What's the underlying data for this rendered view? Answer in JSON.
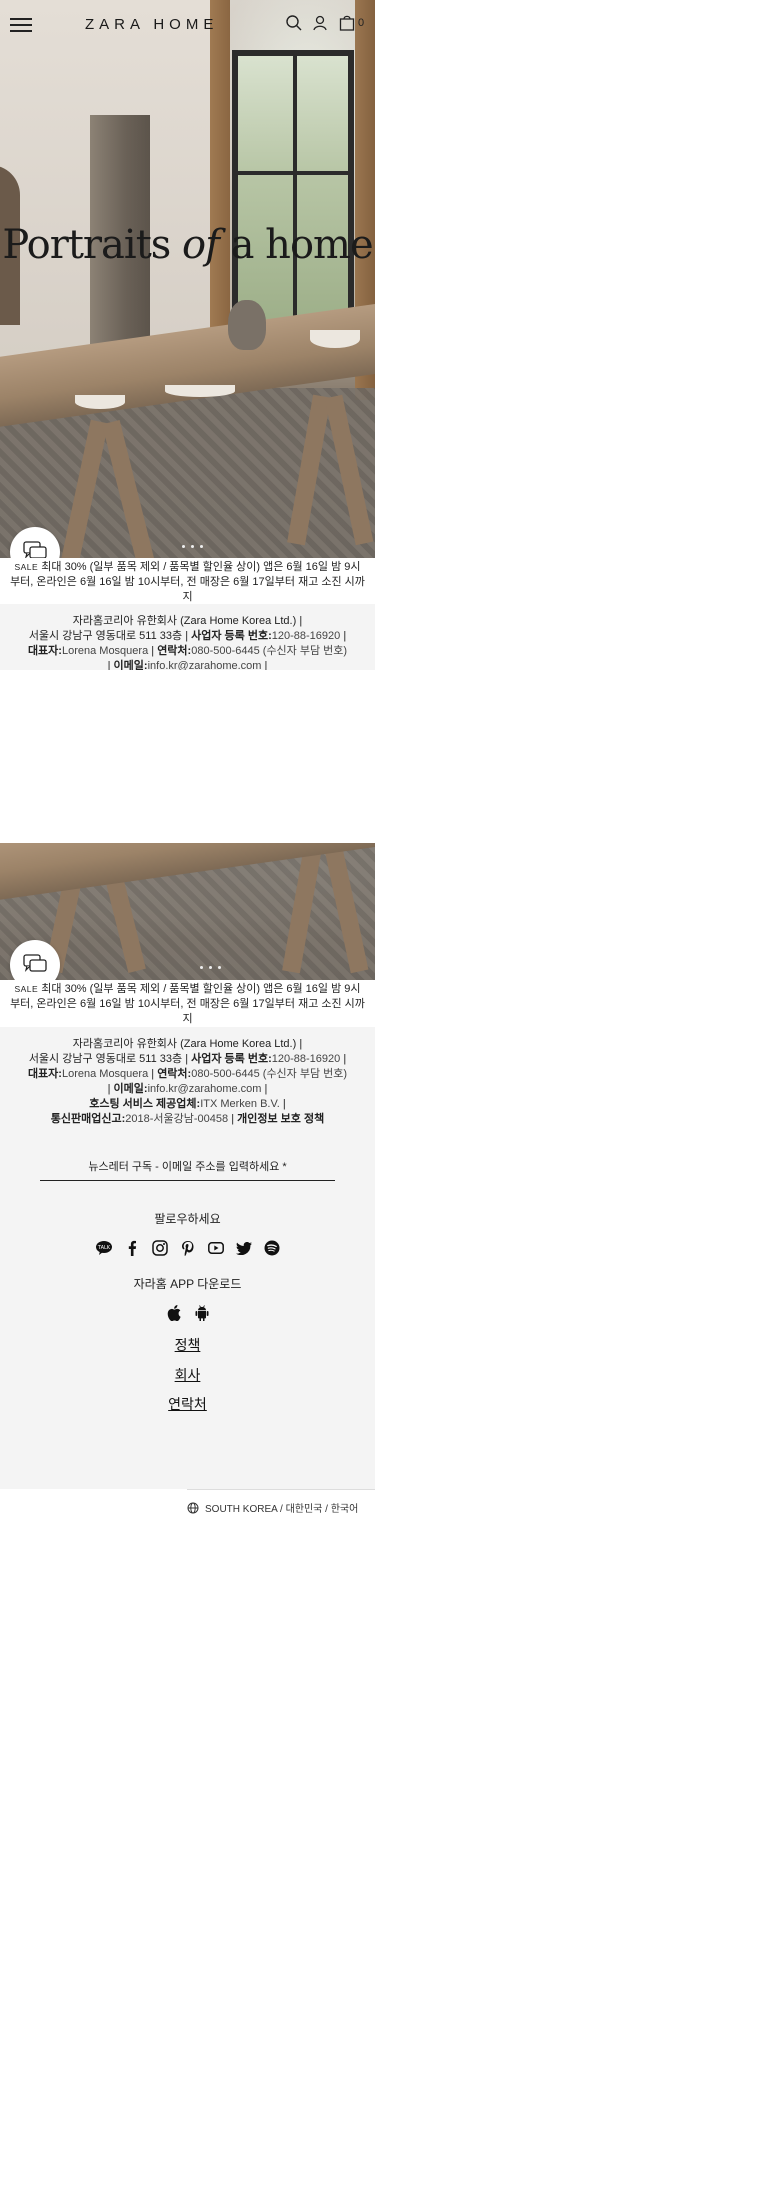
{
  "header": {
    "logo": "ZARA HOME",
    "cart_count": "0"
  },
  "hero": {
    "title_part1": "Portraits ",
    "title_italic": "of",
    "title_part2": " a home"
  },
  "sale_banner": {
    "sale_word": "SALE",
    "text": " 최대 30% (일부 품목 제외 / 품목별 할인율 상이) 앱은 6월 16일 밤 9시부터, 온라인은 6월 16일 밤 10시부터, 전 매장은 6월 17일부터 재고 소진 시까지"
  },
  "company": {
    "name": "자라홈코리아 유한회사 (Zara Home Korea Ltd.)",
    "address": "서울시 강남구 영동대로 511 33층",
    "bizno_label": "사업자 등록 번호:",
    "bizno": "120-88-16920",
    "ceo_label": "대표자:",
    "ceo": "Lorena Mosquera",
    "contact_label": "연락처:",
    "contact": "080-500-6445 (수신자 부담 번호)",
    "email_label": "이메일:",
    "email": "info.kr@zarahome.com",
    "hosting_label": "호스팅 서비스 제공업체:",
    "hosting": "ITX Merken B.V.",
    "mailorder_label": "통신판매업신고:",
    "mailorder": "2018-서울강남-00458",
    "privacy": "개인정보 보호 정책"
  },
  "newsletter": {
    "placeholder": "뉴스레터 구독 - 이메일 주소를 입력하세요 *"
  },
  "follow": {
    "title": "팔로우하세요",
    "icons": [
      "kakao-icon",
      "facebook-icon",
      "instagram-icon",
      "pinterest-icon",
      "youtube-icon",
      "twitter-icon",
      "spotify-icon"
    ]
  },
  "app": {
    "title": "자라홈 APP 다운로드",
    "icons": [
      "apple-icon",
      "android-icon"
    ]
  },
  "links": {
    "policy": "정책",
    "company": "회사",
    "contact": "연락처"
  },
  "region": {
    "label": "SOUTH KOREA / 대한민국 / 한국어"
  }
}
